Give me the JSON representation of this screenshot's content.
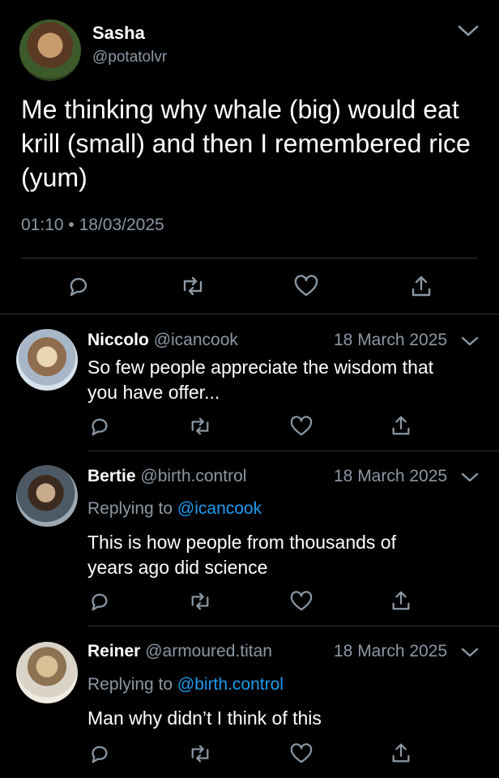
{
  "main_tweet": {
    "name": "Sasha",
    "handle": "@potatolvr",
    "text": "Me thinking why whale (big) would eat krill (small) and then I remembered rice (yum)",
    "timestamp": "01:10 • 18/03/2025",
    "icons": [
      "reply-icon",
      "retweet-icon",
      "like-icon",
      "share-icon",
      "chevron-down-icon"
    ]
  },
  "replies": [
    {
      "name": "Niccolo",
      "handle": "@icancook",
      "date": "18 March 2025",
      "text_line1": "So few people appreciate the wisdom that",
      "text_line2": "you have offer..."
    },
    {
      "name": "Bertie",
      "handle": "@birth.control",
      "date": "18 March 2025",
      "replying_prefix": "Replying to",
      "replying_to": "@icancook",
      "text_line1": "This is how people from thousands of",
      "text_line2": "years ago did science"
    },
    {
      "name": "Reiner",
      "handle": "@armoured.titan",
      "date": "18 March 2025",
      "replying_prefix": "Replying to",
      "replying_to": "@birth.control",
      "text_line1": "Man why didn’t I think of this"
    }
  ],
  "colors": {
    "background": "#000000",
    "muted_text": "#8b98a5",
    "link": "#1d9bf0",
    "divider": "#2f3336"
  }
}
